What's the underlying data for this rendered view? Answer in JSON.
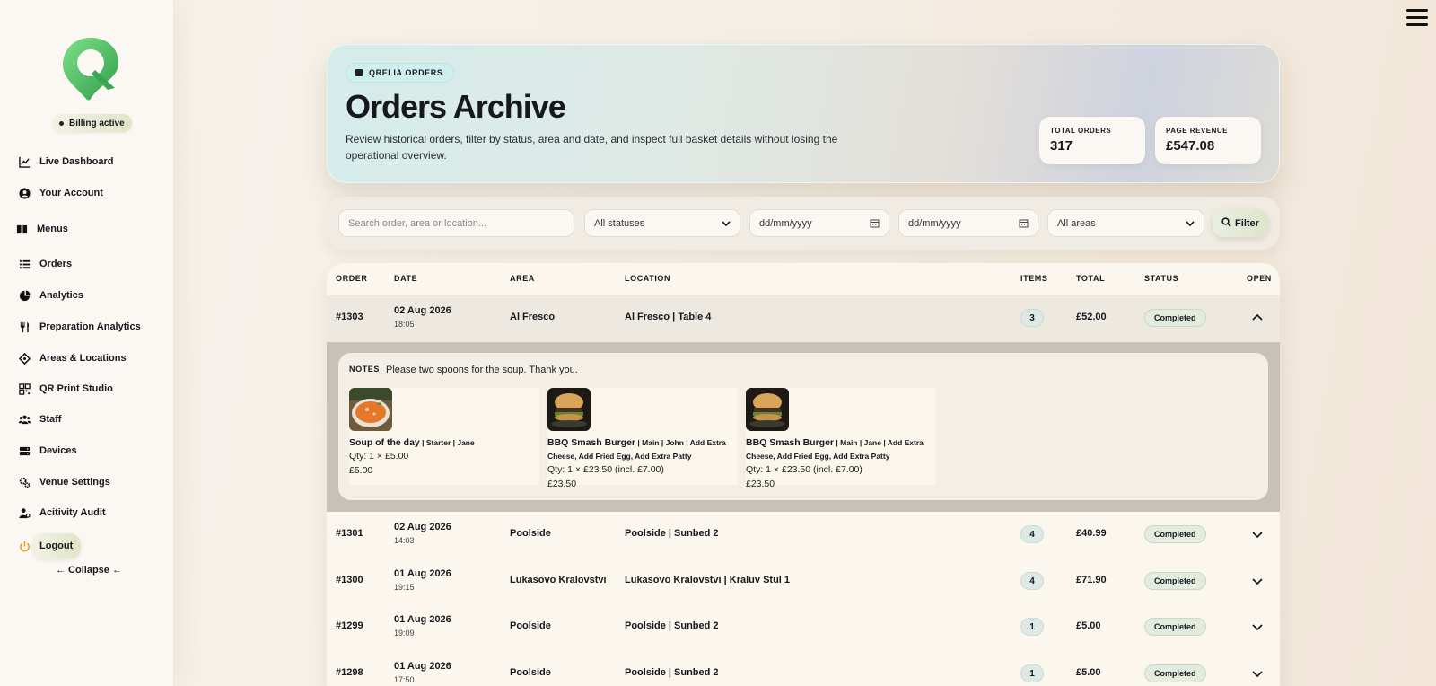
{
  "sidebar": {
    "billing": "Billing active",
    "items": [
      {
        "label": "Live Dashboard",
        "icon": "chart-line-icon"
      },
      {
        "label": "Your Account",
        "icon": "user-circle-icon"
      },
      {
        "label": "Menus",
        "icon": "book-icon"
      },
      {
        "label": "Orders",
        "icon": "list-icon"
      },
      {
        "label": "Analytics",
        "icon": "pie-chart-icon"
      },
      {
        "label": "Preparation Analytics",
        "icon": "utensils-icon"
      },
      {
        "label": "Areas & Locations",
        "icon": "location-diamond-icon"
      },
      {
        "label": "QR Print Studio",
        "icon": "qr-icon"
      },
      {
        "label": "Staff",
        "icon": "users-icon"
      },
      {
        "label": "Devices",
        "icon": "server-icon"
      },
      {
        "label": "Venue Settings",
        "icon": "gears-icon"
      },
      {
        "label": "Acitivity Audit",
        "icon": "user-cog-icon"
      },
      {
        "label": "Logout",
        "icon": "power-icon"
      }
    ],
    "collapse": "← Collapse ←"
  },
  "hero": {
    "badge": "QRELIA ORDERS",
    "title": "Orders Archive",
    "description": "Review historical orders, filter by status, area and date, and inspect full basket details without losing the operational overview.",
    "stats": [
      {
        "label": "TOTAL ORDERS",
        "value": "317"
      },
      {
        "label": "PAGE REVENUE",
        "value": "£547.08"
      }
    ]
  },
  "filters": {
    "search_placeholder": "Search order, area or location...",
    "status": "All statuses",
    "date_from": "dd/mm/yyyy",
    "date_to": "dd/mm/yyyy",
    "area": "All areas",
    "button": "Filter"
  },
  "table": {
    "headers": [
      "ORDER",
      "DATE",
      "AREA",
      "LOCATION",
      "ITEMS",
      "TOTAL",
      "STATUS",
      "OPEN"
    ],
    "rows": [
      {
        "order": "#1303",
        "date": "02 Aug 2026",
        "time": "18:05",
        "area": "Al Fresco",
        "location": "Al Fresco | Table 4",
        "items": "3",
        "total": "£52.00",
        "status": "Completed"
      },
      {
        "order": "#1301",
        "date": "02 Aug 2026",
        "time": "14:03",
        "area": "Poolside",
        "location": "Poolside | Sunbed 2",
        "items": "4",
        "total": "£40.99",
        "status": "Completed"
      },
      {
        "order": "#1300",
        "date": "01 Aug 2026",
        "time": "19:15",
        "area": "Lukasovo Kralovstvi",
        "location": "Lukasovo Kralovstvi | Kraluv Stul 1",
        "items": "4",
        "total": "£71.90",
        "status": "Completed"
      },
      {
        "order": "#1299",
        "date": "01 Aug 2026",
        "time": "19:09",
        "area": "Poolside",
        "location": "Poolside | Sunbed 2",
        "items": "1",
        "total": "£5.00",
        "status": "Completed"
      },
      {
        "order": "#1298",
        "date": "01 Aug 2026",
        "time": "17:50",
        "area": "Poolside",
        "location": "Poolside | Sunbed 2",
        "items": "1",
        "total": "£5.00",
        "status": "Completed"
      }
    ],
    "detail": {
      "notes_label": "NOTES",
      "notes": "Please two spoons for the soup. Thank you.",
      "items": [
        {
          "name": "Soup of the day",
          "meta": " | Starter | Jane",
          "qty": "Qty: 1 × £5.00",
          "price": "£5.00",
          "image": "soup"
        },
        {
          "name": "BBQ Smash Burger",
          "meta": " | Main | John | Add Extra Cheese, Add Fried Egg, Add Extra Patty",
          "qty": "Qty: 1 × £23.50 (incl. £7.00)",
          "price": "£23.50",
          "image": "burger"
        },
        {
          "name": "BBQ Smash Burger",
          "meta": " | Main | Jane | Add Extra Cheese, Add Fried Egg, Add Extra Patty",
          "qty": "Qty: 1 × £23.50 (incl. £7.00)",
          "price": "£23.50",
          "image": "burger"
        }
      ]
    }
  },
  "colors": {
    "accent_green": "#4caf50",
    "status_bg": "#e3ecdf"
  }
}
